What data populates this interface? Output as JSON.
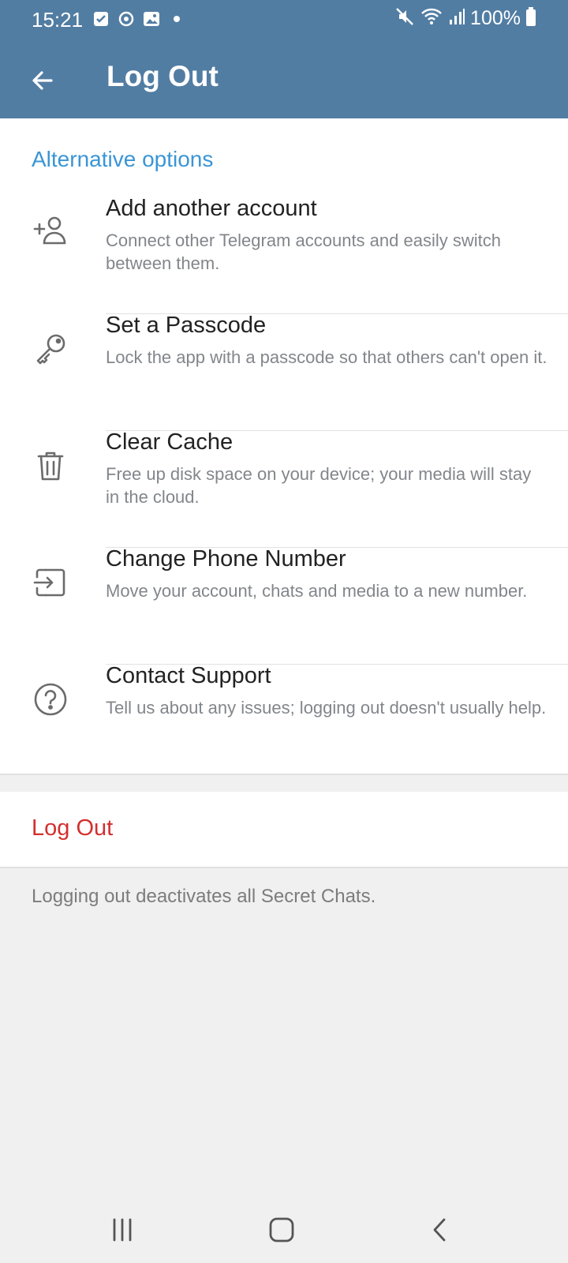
{
  "status_bar": {
    "time": "15:21",
    "battery": "100%",
    "icons": [
      "checkbox-notif-icon",
      "sync-notif-icon",
      "image-notif-icon",
      "dot-icon",
      "mute-icon",
      "wifi-icon",
      "signal-icon",
      "battery-icon"
    ]
  },
  "app_bar": {
    "title": "Log Out",
    "back_icon": "arrow-left-icon"
  },
  "options": {
    "section_title": "Alternative options",
    "items": [
      {
        "title": "Add another account",
        "description": "Connect other Telegram accounts and easily switch between them.",
        "icon": "add-user-icon"
      },
      {
        "title": "Set a Passcode",
        "description": "Lock the app with a passcode so that others can't open it.",
        "icon": "key-icon"
      },
      {
        "title": "Clear Cache",
        "description": "Free up disk space on your device; your media will stay in the cloud.",
        "icon": "trash-icon"
      },
      {
        "title": "Change Phone Number",
        "description": "Move your account, chats and media to a new number.",
        "icon": "switch-number-icon"
      },
      {
        "title": "Contact Support",
        "description": "Tell us about any issues; logging out doesn't usually help.",
        "icon": "help-icon"
      }
    ]
  },
  "logout": {
    "label": "Log Out",
    "note": "Logging out deactivates all Secret Chats."
  },
  "colors": {
    "header": "#527da3",
    "accent": "#3a95d5",
    "danger": "#d32f2f",
    "background": "#f0f0f0"
  }
}
